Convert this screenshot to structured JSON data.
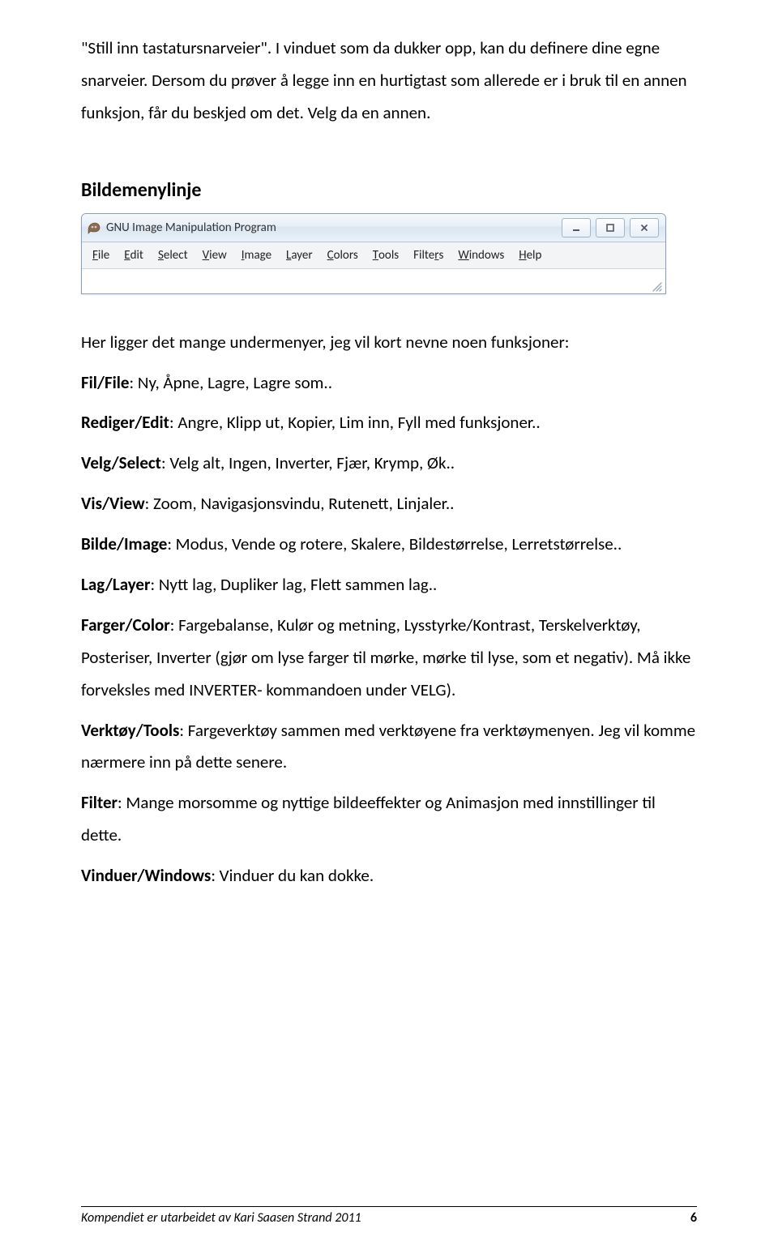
{
  "intro": {
    "p1": "\"Still inn tastatursnarveier\". I vinduet som da dukker opp, kan du definere dine egne snarveier. Dersom du prøver å legge inn en hurtigtast som allerede er i bruk til en annen funksjon, får du beskjed om det. Velg da en annen."
  },
  "section_title": "Bildemenylinje",
  "gimp": {
    "title": "GNU Image Manipulation Program",
    "menu": [
      {
        "accel": "F",
        "rest": "ile"
      },
      {
        "accel": "E",
        "rest": "dit"
      },
      {
        "accel": "S",
        "rest": "elect"
      },
      {
        "accel": "V",
        "rest": "iew"
      },
      {
        "accel": "I",
        "rest": "mage"
      },
      {
        "accel": "L",
        "rest": "ayer"
      },
      {
        "accel": "C",
        "rest": "olors"
      },
      {
        "accel": "T",
        "rest": "ools"
      },
      {
        "accel": "",
        "rest": "Filte",
        "accel2": "r",
        "rest2": "s"
      },
      {
        "accel": "W",
        "rest": "indows"
      },
      {
        "accel": "H",
        "rest": "elp"
      }
    ]
  },
  "body2_intro": "Her ligger det mange undermenyer, jeg vil kort nevne noen funksjoner:",
  "items": {
    "fil": {
      "label": "Fil/File",
      "text": ": Ny, Åpne, Lagre, Lagre som.."
    },
    "rediger": {
      "label": "Rediger/Edit",
      "text": ": Angre, Klipp ut, Kopier, Lim inn, Fyll med funksjoner.."
    },
    "velg": {
      "label": "Velg/Select",
      "text": ": Velg alt, Ingen, Inverter, Fjær, Krymp, Øk.."
    },
    "vis": {
      "label": "Vis/View",
      "text": ": Zoom, Navigasjonsvindu, Rutenett, Linjaler.."
    },
    "bilde": {
      "label": "Bilde/Image",
      "text": ": Modus, Vende og rotere, Skalere, Bildestørrelse, Lerretstørrelse.."
    },
    "lag": {
      "label": "Lag/Layer",
      "text": ": Nytt lag, Dupliker lag, Flett sammen lag.."
    },
    "farger": {
      "label": "Farger/Color",
      "text": ": Fargebalanse, Kulør og metning, Lysstyrke/Kontrast, Terskelverktøy, Posteriser, Inverter (gjør om lyse farger til mørke, mørke til lyse, som et negativ). Må ikke forveksles med INVERTER- kommandoen under VELG)."
    },
    "verktoy": {
      "label": "Verktøy/Tools",
      "text": ": Fargeverktøy sammen med verktøyene fra verktøymenyen. Jeg vil komme nærmere inn på dette senere."
    },
    "filter": {
      "label": "Filter",
      "text": ": Mange morsomme og nyttige bildeeffekter og Animasjon med innstillinger til dette."
    },
    "vinduer": {
      "label": "Vinduer/Windows",
      "text": ": Vinduer du kan dokke."
    }
  },
  "footer": {
    "text": "Kompendiet er utarbeidet av Kari Saasen Strand 2011",
    "page": "6"
  }
}
